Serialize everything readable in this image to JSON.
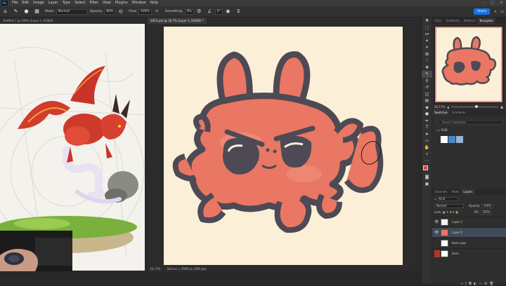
{
  "menu": {
    "items": [
      "File",
      "Edit",
      "Image",
      "Layer",
      "Type",
      "Select",
      "Filter",
      "View",
      "Plugins",
      "Window",
      "Help"
    ],
    "app_icon": "Ps"
  },
  "options_bar": {
    "mode_label": "Mode:",
    "mode_value": "Normal",
    "opacity_label": "Opacity:",
    "opacity_value": "80%",
    "flow_label": "Flow:",
    "flow_value": "100%",
    "smoothing_label": "Smoothing:",
    "smoothing_value": "0%",
    "angle_value": "0°",
    "share_label": "Share"
  },
  "tabs": [
    {
      "label": "DotMod 1 @ 100% (Layer 1, RGB/8)",
      "active": false
    },
    {
      "label": "2812.psd @ 16.7% (Layer 1, RGB/8) *",
      "active": true
    }
  ],
  "status": {
    "zoom": "16.17%",
    "doc_size": "Skill on = 5569 px (300 ppi)"
  },
  "panels": {
    "top_tabs": [
      "Color",
      "Gradients",
      "Patterns",
      "Navigator"
    ],
    "top_active": "Navigator",
    "nav_zoom": "16.17%",
    "mid_tabs": [
      "Swatches",
      "Gradients"
    ],
    "mid_active": "Swatches",
    "swatch_search_placeholder": "Search Swatches",
    "swatch_folder": "RGB",
    "swatch_colors": [
      "#ffffff",
      "#4a86c9",
      "#9ab4d4"
    ],
    "layer_tabs": [
      "Channels",
      "Paths",
      "Layers"
    ],
    "layer_active": "Layers",
    "kind_label": "Kind",
    "blend_mode": "Normal",
    "opacity_label": "Opacity:",
    "opacity_value": "100%",
    "lock_label": "Lock:",
    "fill_label": "Fill:",
    "fill_value": "100%",
    "layers": [
      {
        "name": "Layer 2",
        "visible": true,
        "selected": false,
        "thumb": "sketch"
      },
      {
        "name": "Layer 1",
        "visible": true,
        "selected": true,
        "thumb": "color"
      },
      {
        "name": "base copy",
        "visible": false,
        "selected": false,
        "thumb": "white"
      },
      {
        "name": "base",
        "visible": false,
        "selected": false,
        "thumb": "white"
      }
    ]
  },
  "colors": {
    "accent": "#1473e6",
    "creature_fill": "#e97763",
    "creature_outline": "#4d4a55",
    "canvas_bg": "#fcefd7",
    "foreground": "#d9443a",
    "background": "#ffffff"
  }
}
